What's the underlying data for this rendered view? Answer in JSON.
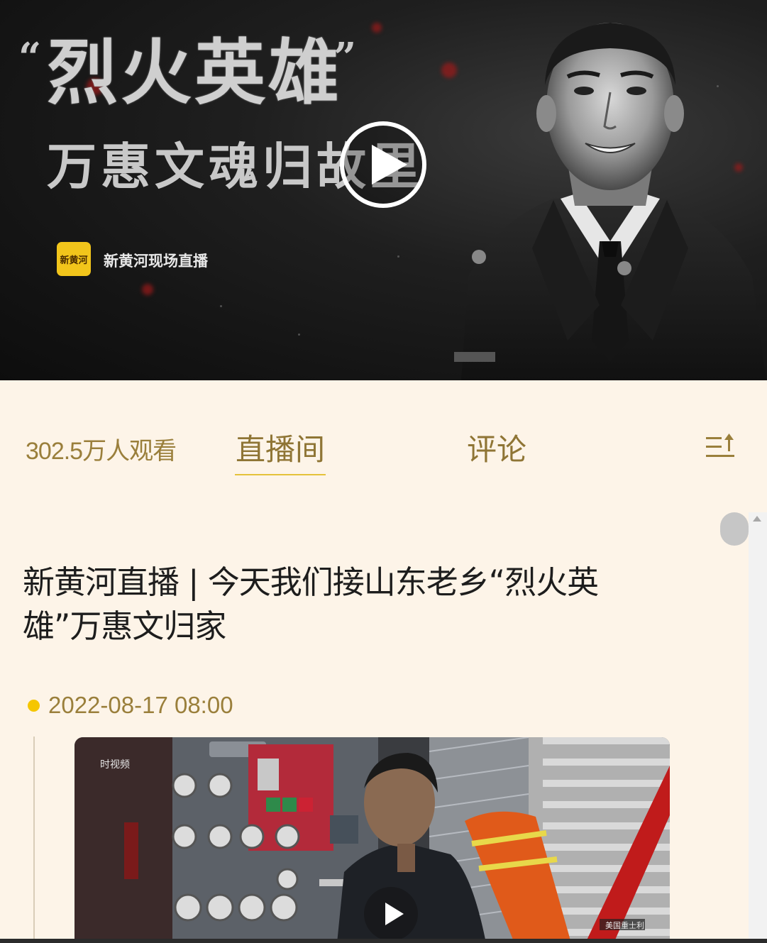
{
  "hero": {
    "quote_open": "“",
    "quote_close": "”",
    "title_line1": "烈火英雄",
    "title_line2": "万惠文魂归故里",
    "logo_text": "新黄河",
    "brand_text": "新黄河现场直播",
    "play_icon": "play-circle-icon"
  },
  "tabs": {
    "views": "302.5万人观看",
    "live_room": "直播间",
    "comments": "评论",
    "sort_icon": "sort-list-icon"
  },
  "article": {
    "title": "新黄河直播 | 今天我们接山东老乡“烈火英雄”万惠文归家",
    "timestamp": "2022-08-17 08:00",
    "video_watermark": "时视频",
    "video_tag": "美国重士利"
  },
  "colors": {
    "background": "#fdf4e8",
    "accent_gold": "#9a7f3b",
    "underline": "#e4c23a",
    "dot": "#f5c600"
  }
}
